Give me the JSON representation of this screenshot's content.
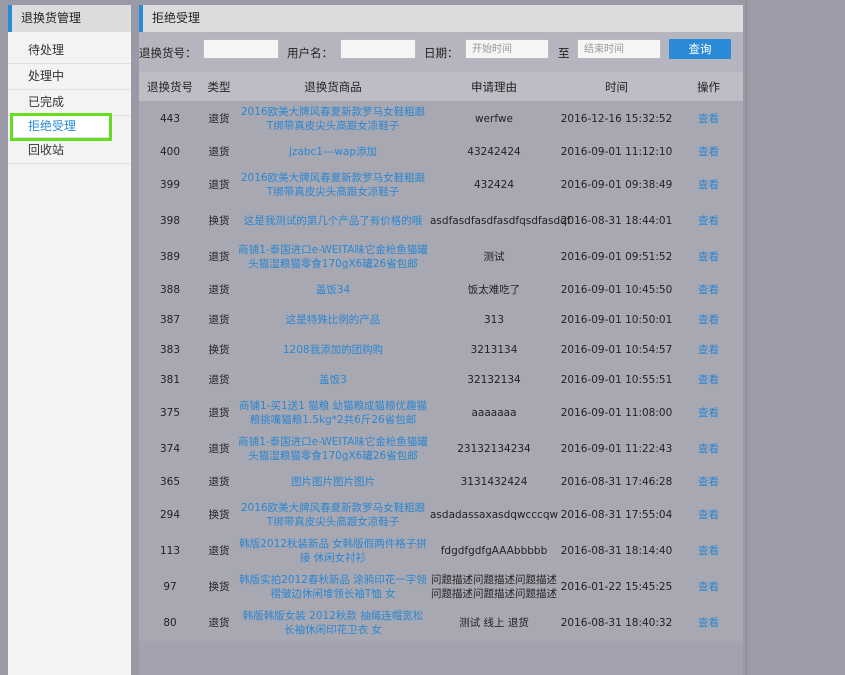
{
  "sidebar": {
    "title": "退换货管理",
    "items": [
      {
        "label": "待处理"
      },
      {
        "label": "处理中"
      },
      {
        "label": "已完成"
      },
      {
        "label": "拒绝受理"
      },
      {
        "label": "回收站"
      }
    ]
  },
  "main": {
    "title": "拒绝受理",
    "search": {
      "return_no_label": "退换货号：",
      "username_label": "用户名：",
      "date_label": "日期：",
      "start_placeholder": "开始时间",
      "to_label": "至",
      "end_placeholder": "结束时间",
      "query_label": "查询"
    },
    "table": {
      "headers": [
        "退换货号",
        "类型",
        "退换货商品",
        "申请理由",
        "时间",
        "操作"
      ],
      "rows": [
        {
          "id": "443",
          "type": "退货",
          "product": "2016欧美大牌风春夏新款罗马女鞋粗跟T绑带真皮尖头高跟女凉鞋子",
          "reason": "werfwe",
          "time": "2016-12-16 15:32:52",
          "op": "查看"
        },
        {
          "id": "400",
          "type": "退货",
          "product": "jzabc1---wap添加",
          "reason": "43242424",
          "time": "2016-09-01 11:12:10",
          "op": "查看"
        },
        {
          "id": "399",
          "type": "退货",
          "product": "2016欧美大牌风春夏新款罗马女鞋粗跟T绑带真皮尖头高跟女凉鞋子",
          "reason": "432424",
          "time": "2016-09-01 09:38:49",
          "op": "查看"
        },
        {
          "id": "398",
          "type": "换货",
          "product": "这是我测试的第几个产品了有价格的哦",
          "reason": "asdfasdfasdfasdfqsdfasdqf",
          "time": "2016-08-31 18:44:01",
          "op": "查看"
        },
        {
          "id": "389",
          "type": "退货",
          "product": "商铺1-泰国进口e-WEITA味它金枪鱼猫罐头猫湿粮猫零食170gX6罐26省包邮",
          "reason": "测试",
          "time": "2016-09-01 09:51:52",
          "op": "查看"
        },
        {
          "id": "388",
          "type": "退货",
          "product": "盖饭34",
          "reason": "饭太难吃了",
          "time": "2016-09-01 10:45:50",
          "op": "查看"
        },
        {
          "id": "387",
          "type": "退货",
          "product": "这是特殊比例的产品",
          "reason": "313",
          "time": "2016-09-01 10:50:01",
          "op": "查看"
        },
        {
          "id": "383",
          "type": "换货",
          "product": "1208我添加的团购购",
          "reason": "3213134",
          "time": "2016-09-01 10:54:57",
          "op": "查看"
        },
        {
          "id": "381",
          "type": "退货",
          "product": "盖饭3",
          "reason": "32132134",
          "time": "2016-09-01 10:55:51",
          "op": "查看"
        },
        {
          "id": "375",
          "type": "退货",
          "product": "商铺1-买1送1 猫粮 幼猫粮成猫粮优趣猫粮挑嘴猫粮1.5kg*2共6斤26省包邮",
          "reason": "aaaaaaa",
          "time": "2016-09-01 11:08:00",
          "op": "查看"
        },
        {
          "id": "374",
          "type": "退货",
          "product": "商铺1-泰国进口e-WEITA味它金枪鱼猫罐头猫湿粮猫零食170gX6罐26省包邮",
          "reason": "23132134234",
          "time": "2016-09-01 11:22:43",
          "op": "查看"
        },
        {
          "id": "365",
          "type": "退货",
          "product": "图片图片图片图片",
          "reason": "3131432424",
          "time": "2016-08-31 17:46:28",
          "op": "查看"
        },
        {
          "id": "294",
          "type": "换货",
          "product": "2016欧美大牌风春夏新款罗马女鞋粗跟T绑带真皮尖头高跟女凉鞋子",
          "reason": "asdadassaxasdqwcccqw",
          "time": "2016-08-31 17:55:04",
          "op": "查看"
        },
        {
          "id": "113",
          "type": "退货",
          "product": "韩版2012秋装新品 女韩版假两件格子拼接 休闲女衬衫",
          "reason": "fdgdfgdfgAAAbbbbb",
          "time": "2016-08-31 18:14:40",
          "op": "查看"
        },
        {
          "id": "97",
          "type": "换货",
          "product": "韩版实拍2012春秋新品 涂鸦印花一字领褶皱边休闲堆领长袖T恤 女",
          "reason": "问题描述问题描述问题描述问题描述问题描述问题描述",
          "time": "2016-01-22 15:45:25",
          "op": "查看"
        },
        {
          "id": "80",
          "type": "退货",
          "product": "韩版韩版女装 2012秋款 抽绳连帽宽松长袖休闲印花卫衣 女",
          "reason": "测试 线上 退货",
          "time": "2016-08-31 18:40:32",
          "op": "查看"
        }
      ]
    }
  }
}
